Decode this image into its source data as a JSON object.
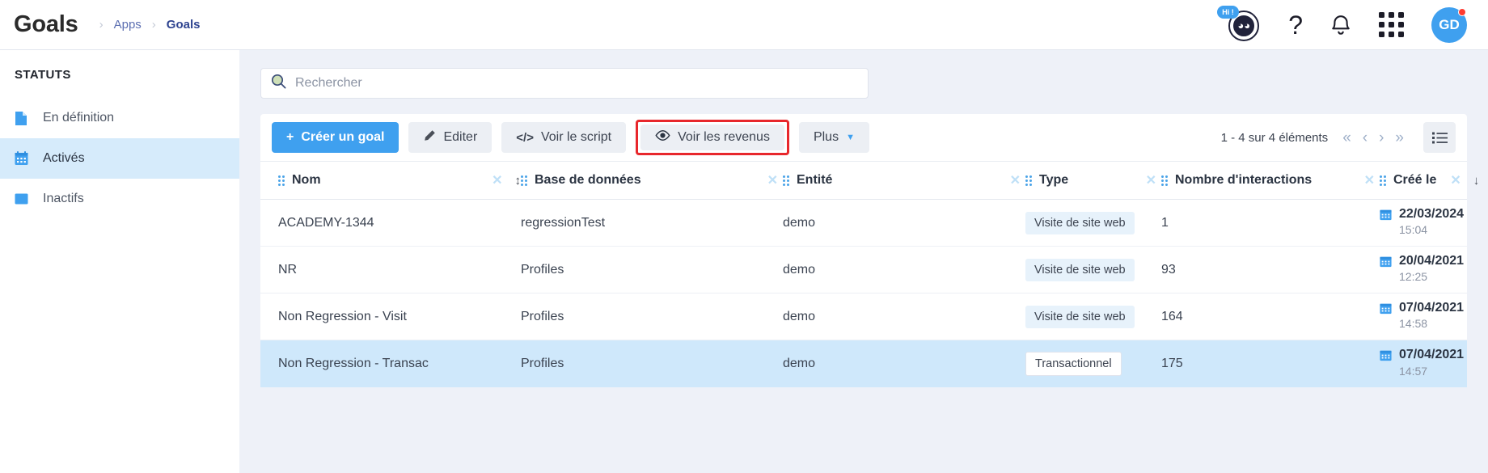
{
  "header": {
    "title": "Goals",
    "breadcrumb": [
      {
        "label": "Apps"
      },
      {
        "label": "Goals"
      }
    ],
    "assistant_badge": "Hi !",
    "avatar_initials": "GD",
    "icons": [
      "assistant-bot-icon",
      "help-icon",
      "notifications-icon",
      "apps-grid-icon",
      "user-avatar"
    ]
  },
  "sidebar": {
    "heading": "STATUTS",
    "items": [
      {
        "label": "En définition",
        "icon": "document-icon",
        "active": false
      },
      {
        "label": "Activés",
        "icon": "calendar-icon",
        "active": true
      },
      {
        "label": "Inactifs",
        "icon": "square-icon",
        "active": false
      }
    ]
  },
  "search": {
    "placeholder": "Rechercher",
    "value": ""
  },
  "toolbar": {
    "create_label": "Créer un goal",
    "edit_label": "Editer",
    "script_label": "Voir le script",
    "revenue_label": "Voir les revenus",
    "more_label": "Plus",
    "pagination_text": "1 - 4 sur 4 éléments",
    "pager": {
      "first": "«",
      "prev": "‹",
      "next": "›",
      "last": "»"
    },
    "highlight_color": "#e8272c",
    "primary_color": "#3fa0ef"
  },
  "table": {
    "columns": [
      {
        "label": "Nom",
        "sortable": true,
        "sort_glyph": "↕"
      },
      {
        "label": "Base de données"
      },
      {
        "label": "Entité"
      },
      {
        "label": "Type"
      },
      {
        "label": "Nombre d'interactions"
      },
      {
        "label": "Créé le",
        "sort_glyph": "↓"
      }
    ],
    "rows": [
      {
        "nom": "ACADEMY-1344",
        "base": "regressionTest",
        "entite": "demo",
        "type": "Visite de site web",
        "type_style": "tag",
        "interactions": "1",
        "date": "22/03/2024",
        "time": "15:04",
        "selected": false
      },
      {
        "nom": "NR",
        "base": "Profiles",
        "entite": "demo",
        "type": "Visite de site web",
        "type_style": "tag",
        "interactions": "93",
        "date": "20/04/2021",
        "time": "12:25",
        "selected": false
      },
      {
        "nom": "Non Regression - Visit",
        "base": "Profiles",
        "entite": "demo",
        "type": "Visite de site web",
        "type_style": "tag",
        "interactions": "164",
        "date": "07/04/2021",
        "time": "14:58",
        "selected": false
      },
      {
        "nom": "Non Regression - Transac",
        "base": "Profiles",
        "entite": "demo",
        "type": "Transactionnel",
        "type_style": "tag-alt",
        "interactions": "175",
        "date": "07/04/2021",
        "time": "14:57",
        "selected": true
      }
    ]
  }
}
